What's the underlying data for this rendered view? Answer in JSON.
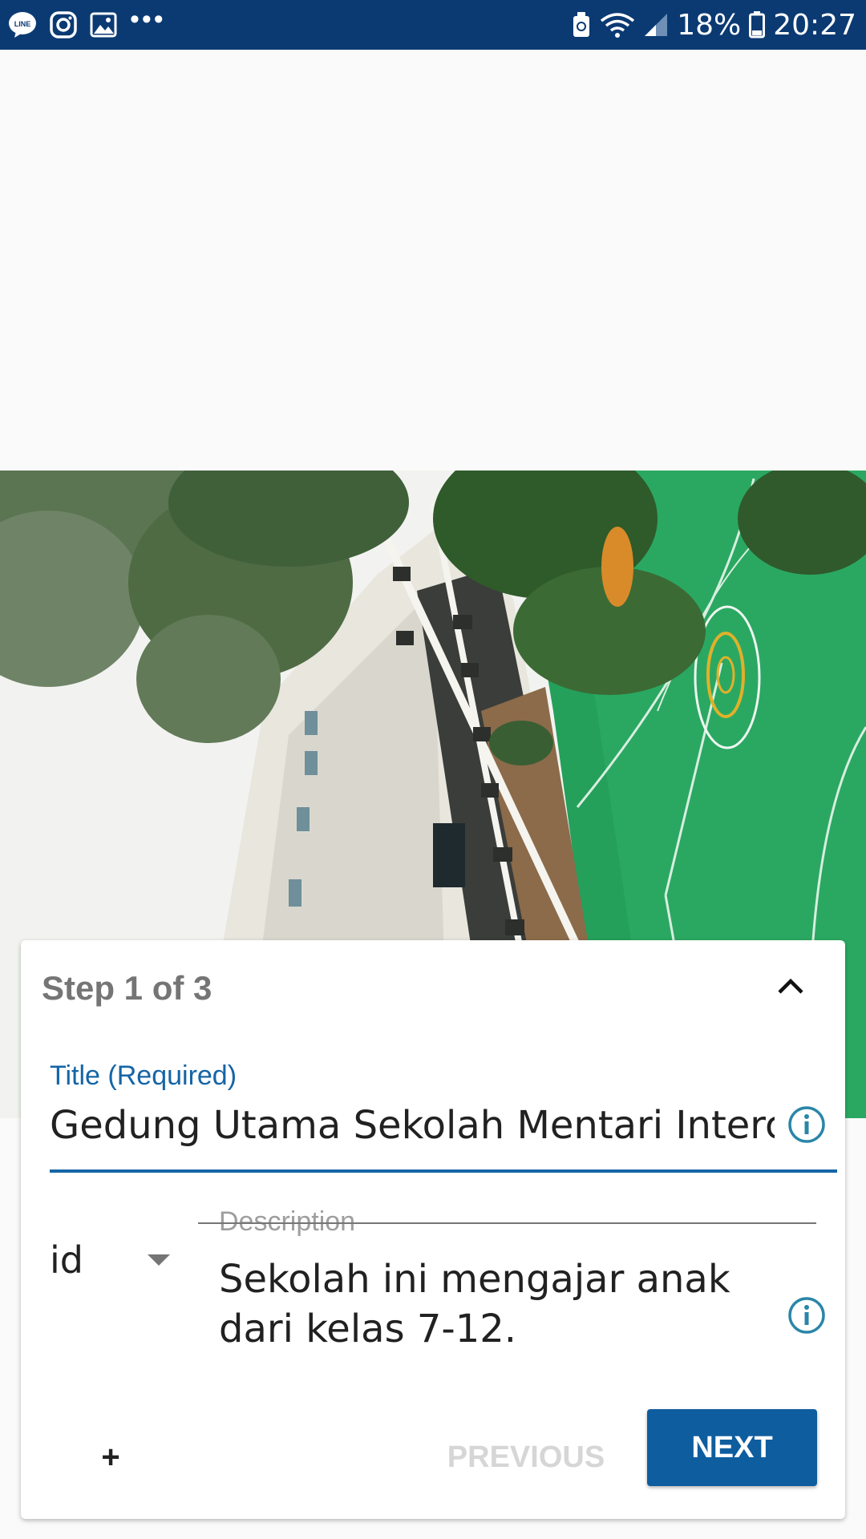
{
  "status_bar": {
    "icons_left": [
      "line-icon",
      "instagram-icon",
      "gallery-icon",
      "more-dots-icon"
    ],
    "more": "•••",
    "icons_right": [
      "nfc-icon",
      "wifi-icon",
      "signal-icon",
      "battery-icon"
    ],
    "battery": "18%",
    "time": "20:27"
  },
  "photo": {
    "description_icon": "uploaded-photo-school-building"
  },
  "card": {
    "step": "Step 1 of 3",
    "collapse_icon": "chevron-up-icon",
    "title_label": "Title (Required)",
    "title_value": "Gedung Utama Sekolah Mentari Intercultural School Jakarta",
    "language": "id",
    "description_label": "Description",
    "description_value": "Sekolah ini mengajar anak dari kelas 7-12.",
    "info_icon": "info-icon",
    "add_label": "+",
    "previous_label": "PREVIOUS",
    "next_label": "NEXT"
  },
  "colors": {
    "status_bar": "#0b3a73",
    "accent": "#1565a6",
    "next_button": "#0e5d9f",
    "disabled_text": "#d6d6d6"
  }
}
